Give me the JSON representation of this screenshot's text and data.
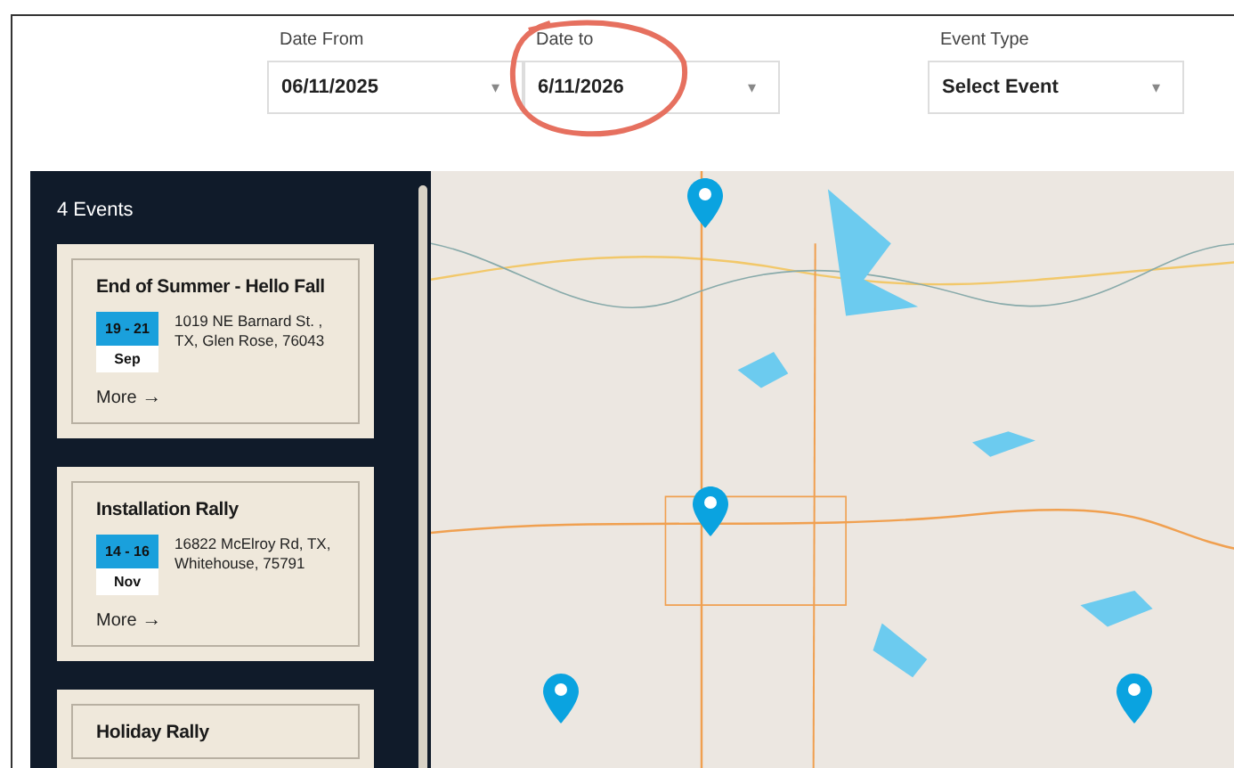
{
  "filters": [
    {
      "label": "Date From",
      "value": "06/11/2025",
      "caret": "▾"
    },
    {
      "label": "Date to",
      "value": "6/11/2026",
      "caret": "▾"
    },
    {
      "label": "Event Type",
      "value": "Select Event",
      "caret": "▾"
    }
  ],
  "events_panel": {
    "count": "4 Events",
    "events": [
      {
        "title": "End of Summer - Hello Fall",
        "days": "19 - 21",
        "month": "Sep",
        "address": "1019 NE Barnard St. , TX, Glen Rose, 76043",
        "more": "More",
        "arrow": "→"
      },
      {
        "title": "Installation Rally",
        "days": "14 - 16",
        "month": "Nov",
        "address": "16822 McElroy Rd, TX, Whitehouse, 75791",
        "more": "More",
        "arrow": "→"
      },
      {
        "title": "Holiday Rally"
      }
    ]
  }
}
